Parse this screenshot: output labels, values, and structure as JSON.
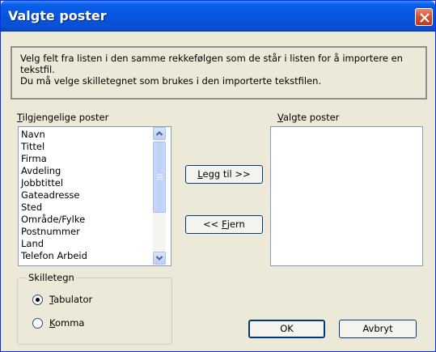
{
  "window": {
    "title": "Valgte poster"
  },
  "info": {
    "line1": "Velg felt fra listen i den samme rekkefølgen som de står i listen for å importere en",
    "line2": "tekstfil.",
    "line3": "Du må velge skilletegnet som brukes i den importerte tekstfilen."
  },
  "available": {
    "label_first": "T",
    "label_rest": "ilgjengelige poster",
    "items": [
      "Navn",
      "Tittel",
      "Firma",
      "Avdeling",
      "Jobbtittel",
      "Gateadresse",
      "Sted",
      "Område/Fylke",
      "Postnummer",
      "Land",
      "Telefon Arbeid"
    ]
  },
  "selected": {
    "label_first": "V",
    "label_rest": "algte poster",
    "items": []
  },
  "buttons": {
    "add_first": "L",
    "add_rest": "egg til >>",
    "remove_pre": "<< ",
    "remove_u": "F",
    "remove_rest": "jern",
    "ok": "OK",
    "cancel": "Avbryt"
  },
  "separator": {
    "legend": "Skilletegn",
    "options": [
      {
        "pre": "",
        "u": "T",
        "rest": "abulator",
        "selected": true
      },
      {
        "pre": "",
        "u": "K",
        "rest": "omma",
        "selected": false
      }
    ]
  }
}
